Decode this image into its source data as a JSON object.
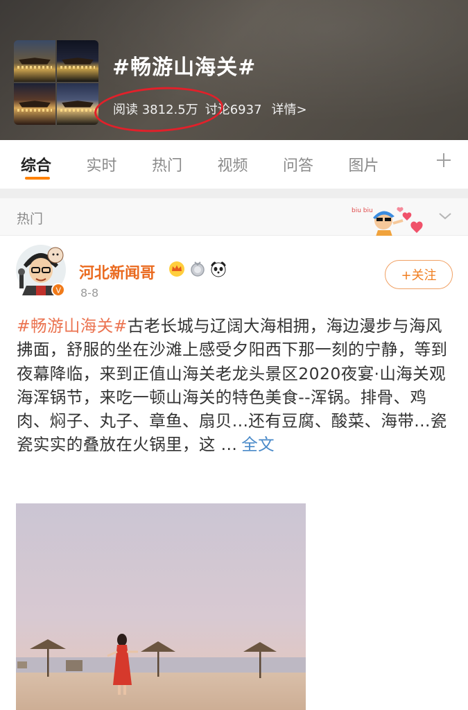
{
  "topic": {
    "title": "#畅游山海关#",
    "read_label": "阅读",
    "read_count": "3812.5万",
    "discuss_label": "讨论",
    "discuss_count": "6937",
    "detail_label": "详情>"
  },
  "tabs": [
    {
      "label": "综合",
      "active": true
    },
    {
      "label": "实时",
      "active": false
    },
    {
      "label": "热门",
      "active": false
    },
    {
      "label": "视频",
      "active": false
    },
    {
      "label": "问答",
      "active": false
    },
    {
      "label": "图片",
      "active": false
    }
  ],
  "tab_add_icon": "plus-icon",
  "section": {
    "label": "热门",
    "sticker_text": "biu biu"
  },
  "post": {
    "author": "河北新闻哥",
    "date": "8-8",
    "follow_label": "+关注",
    "hashtag": "#畅游山海关#",
    "body": "古老长城与辽阔大海相拥，海边漫步与海风拂面，舒服的坐在沙滩上感受夕阳西下那一刻的宁静，等到夜幕降临，来到正值山海关老龙头景区2020夜宴·山海关观海浑锅节，来吃一顿山海关的特色美食--浑锅。排骨、鸡肉、焖子、丸子、章鱼、扇贝...还有豆腐、酸菜、海带...瓷瓷实实的叠放在火锅里，这 ...",
    "full_text_label": "全文"
  },
  "colors": {
    "accent": "#ff8200",
    "author": "#ea6a1f",
    "hashtag": "#eb7350",
    "link": "#4a8ac9",
    "annotation": "#e2202a"
  }
}
